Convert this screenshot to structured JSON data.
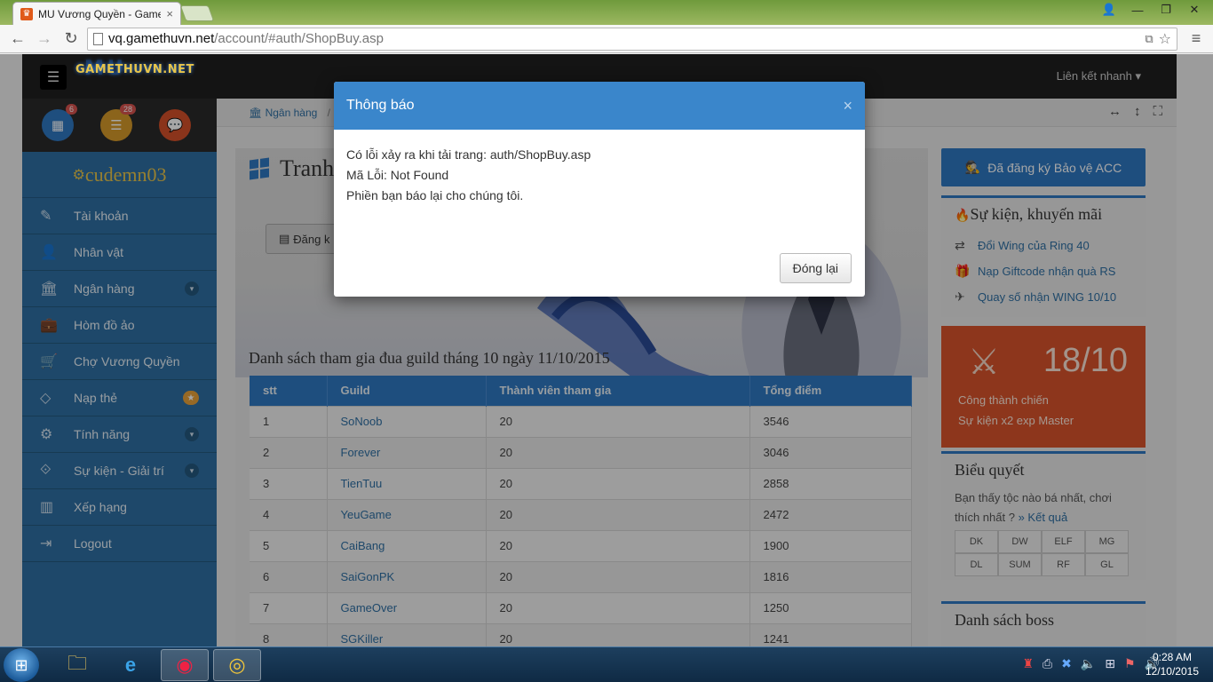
{
  "browser": {
    "tab_title": "MU Vương Quyền - Gameth",
    "url_host": "vq.gamethuvn.net",
    "url_path": "/account/#auth/ShopBuy.asp"
  },
  "header": {
    "logo_big": "MU",
    "logo": "GAMETHUVN.NET",
    "quick_links": "Liên kết nhanh ▾"
  },
  "sidebar": {
    "badges": [
      "6",
      "28"
    ],
    "username": "cudemn03",
    "items": [
      {
        "label": "Tài khoản",
        "icon": "edit-icon"
      },
      {
        "label": "Nhân vật",
        "icon": "user-icon"
      },
      {
        "label": "Ngân hàng",
        "icon": "bank-icon"
      },
      {
        "label": "Hòm đồ ảo",
        "icon": "briefcase-icon"
      },
      {
        "label": "Chợ Vương Quyền",
        "icon": "cart-icon"
      },
      {
        "label": "Nạp thẻ",
        "icon": "diamond-icon"
      },
      {
        "label": "Tính năng",
        "icon": "gears-icon"
      },
      {
        "label": "Sự kiện - Giải trí",
        "icon": "handshake-icon"
      },
      {
        "label": "Xếp hạng",
        "icon": "chart-icon"
      },
      {
        "label": "Logout",
        "icon": "logout-icon"
      }
    ]
  },
  "breadcrumb": {
    "item": "Ngân hàng",
    "sep": "/"
  },
  "main": {
    "title": "Tranh",
    "register_button": "Đăng k",
    "list_title": "Danh sách tham gia đua guild tháng 10 ngày 11/10/2015",
    "columns": [
      "stt",
      "Guild",
      "Thành viên tham gia",
      "Tổng điểm"
    ],
    "rows": [
      [
        "1",
        "SoNoob",
        "20",
        "3546"
      ],
      [
        "2",
        "Forever",
        "20",
        "3046"
      ],
      [
        "3",
        "TienTuu",
        "20",
        "2858"
      ],
      [
        "4",
        "YeuGame",
        "20",
        "2472"
      ],
      [
        "5",
        "CaiBang",
        "20",
        "1900"
      ],
      [
        "6",
        "SaiGonPK",
        "20",
        "1816"
      ],
      [
        "7",
        "GameOver",
        "20",
        "1250"
      ],
      [
        "8",
        "SGKiller",
        "20",
        "1241"
      ]
    ]
  },
  "right": {
    "acc_button": "Đã đăng ký Bảo vệ ACC",
    "events_title": "Sự kiện, khuyến mãi",
    "events": [
      {
        "label": "Đổi Wing của Ring 40",
        "icon": "exchange-icon"
      },
      {
        "label": "Nạp Giftcode nhận quà RS",
        "icon": "gift-icon"
      },
      {
        "label": "Quay số nhận WING 10/10",
        "icon": "plane-icon"
      }
    ],
    "siege_date": "18/10",
    "siege_line1": "Công thành chiến",
    "siege_line2": "Sự kiện x2 exp Master",
    "vote_title": "Biểu quyết",
    "vote_question": "Bạn thấy tộc nào bá nhất, chơi thích nhất ?",
    "vote_result": "» Kết quả",
    "classes": [
      "DK",
      "DW",
      "ELF",
      "MG",
      "DL",
      "SUM",
      "RF",
      "GL"
    ],
    "boss_title": "Danh sách boss"
  },
  "modal": {
    "title": "Thông báo",
    "close": "×",
    "line1": "Có lỗi xảy ra khi tải trang: auth/ShopBuy.asp",
    "line2": "Mã Lỗi: Not Found",
    "line3": "Phiền bạn báo lại cho chúng tôi.",
    "button": "Đóng lại"
  },
  "taskbar": {
    "time": "0:28 AM",
    "date": "12/10/2015"
  }
}
